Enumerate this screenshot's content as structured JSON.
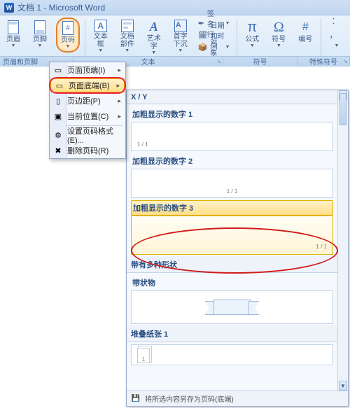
{
  "title": "文档 1 - Microsoft Word",
  "ribbon": {
    "header": "页眉",
    "footer": "页脚",
    "pagenum": "页码",
    "textbox": "文本框",
    "quickparts": "文档部件",
    "wordart": "艺术字",
    "dropcap": "首字下沉",
    "sigline": "签名行",
    "datetime": "日期和时间",
    "object": "对象",
    "equation": "公式",
    "symbol": "符号",
    "number": "编号",
    "ellipsis": "︰ ，",
    "groups": {
      "hf": "页眉和页脚",
      "text": "文本",
      "symbols": "符号",
      "special": "特殊符号"
    }
  },
  "menu": {
    "top": "页面顶端(I)",
    "bottom": "页面底端(B)",
    "margins": "页边距(P)",
    "current": "当前位置(C)",
    "format": "设置页码格式(E)...",
    "remove": "删除页码(R)"
  },
  "gallery": {
    "cat1": "X / Y",
    "items": {
      "b1": "加粗显示的数字 1",
      "b2": "加粗显示的数字 2",
      "b3": "加粗显示的数字 3"
    },
    "cat2": "带有多种形状",
    "ribbonitem": "带状物",
    "cat3": "堆叠纸张 1",
    "footer": "将所选内容另存为页码(底端)"
  },
  "sample": {
    "xy": "1 / 1",
    "one": "1"
  }
}
